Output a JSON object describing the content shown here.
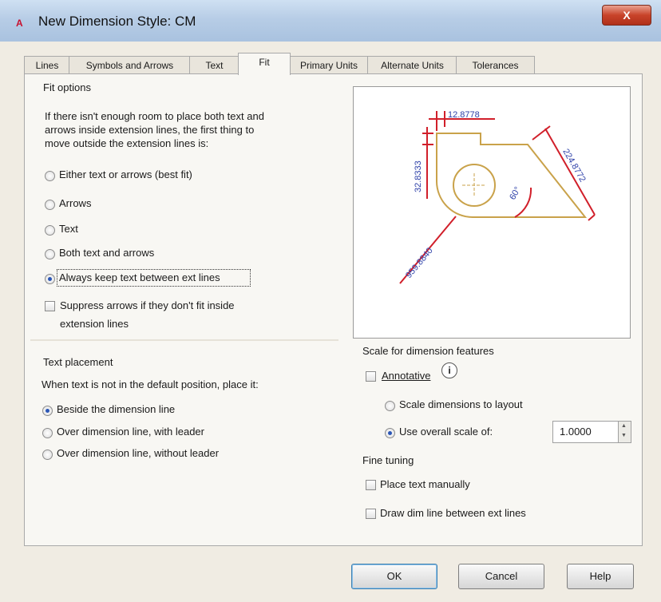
{
  "window": {
    "title": "New Dimension Style: CM",
    "app_icon": "A",
    "close_label": "X"
  },
  "tabs": [
    {
      "label": "Lines"
    },
    {
      "label": "Symbols and Arrows"
    },
    {
      "label": "Text"
    },
    {
      "label": "Fit",
      "active": true
    },
    {
      "label": "Primary Units"
    },
    {
      "label": "Alternate Units"
    },
    {
      "label": "Tolerances"
    }
  ],
  "fit_options": {
    "title": "Fit options",
    "description": [
      "If there isn't enough room to place both text and",
      "arrows inside extension lines, the first thing to",
      "move outside the extension lines is:"
    ],
    "radios": [
      {
        "label": "Either text or arrows (best fit)",
        "checked": false
      },
      {
        "label": "Arrows",
        "checked": false
      },
      {
        "label": "Text",
        "checked": false
      },
      {
        "label": "Both text and arrows",
        "checked": false
      },
      {
        "label": "Always keep text between ext lines",
        "checked": true
      }
    ],
    "suppress_arrows": {
      "label_line1": "Suppress arrows if they don't fit inside",
      "label_line2": "extension lines",
      "checked": false
    }
  },
  "text_placement": {
    "title": "Text placement",
    "description": "When text is not in the default position, place it:",
    "radios": [
      {
        "label": "Beside the dimension line",
        "checked": true
      },
      {
        "label": "Over dimension line, with leader",
        "checked": false
      },
      {
        "label": "Over dimension line, without leader",
        "checked": false
      }
    ]
  },
  "preview": {
    "dim_top": "12.8778",
    "dim_left": "32.8333",
    "dim_right": "224.8772",
    "dim_angle": "60°",
    "dim_leader": "959.8840"
  },
  "scale": {
    "title": "Scale for dimension features",
    "annotative": {
      "label": "Annotative",
      "checked": false
    },
    "info_icon": "i",
    "layout_radio": {
      "label": "Scale dimensions to layout",
      "checked": false
    },
    "overall_radio": {
      "label": "Use overall scale of:",
      "checked": true
    },
    "overall_value": "1.0000"
  },
  "fine_tuning": {
    "title": "Fine tuning",
    "place_text_manually": {
      "label": "Place text manually",
      "checked": false
    },
    "draw_dim_line": {
      "label": "Draw dim line between ext lines",
      "checked": false
    }
  },
  "buttons": {
    "ok": "OK",
    "cancel": "Cancel",
    "help": "Help"
  },
  "colors": {
    "dim_red": "#d11f2a",
    "dim_blue": "#2c3fa8",
    "geometry": "#c9a24a"
  }
}
